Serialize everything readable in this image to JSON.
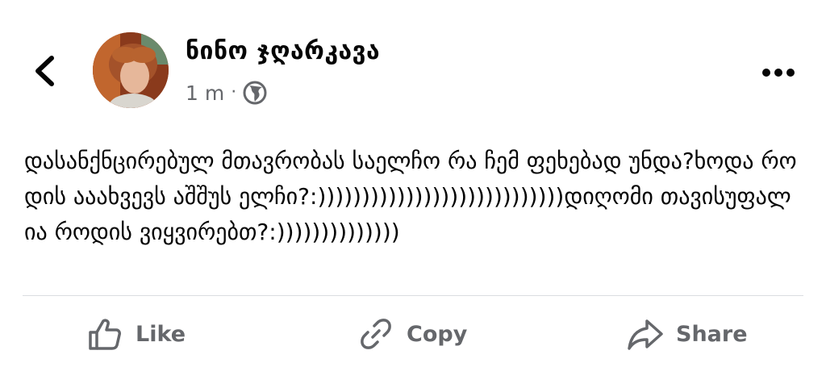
{
  "header": {
    "author_name": "ნინო ჯღარკავა",
    "time_ago": "1 m",
    "separator": "·",
    "audience_icon": "globe-icon",
    "back_icon": "chevron-left-icon",
    "more_icon": "more-horizontal-icon"
  },
  "post": {
    "text": "დასანქნცირებულ მთავრობას საელჩო რა ჩემ ფეხებად უნდა?ხოდა როდის ააახვევს აშშუს ელჩი?:))))))))))))))))))))))))))))დიღომი თავისუფალია როდის ვიყვირებთ?:))))))))))))))"
  },
  "actions": {
    "like_label": "Like",
    "copy_label": "Copy",
    "share_label": "Share"
  },
  "colors": {
    "text": "#050505",
    "secondary": "#65676b",
    "divider": "#dadde1"
  }
}
